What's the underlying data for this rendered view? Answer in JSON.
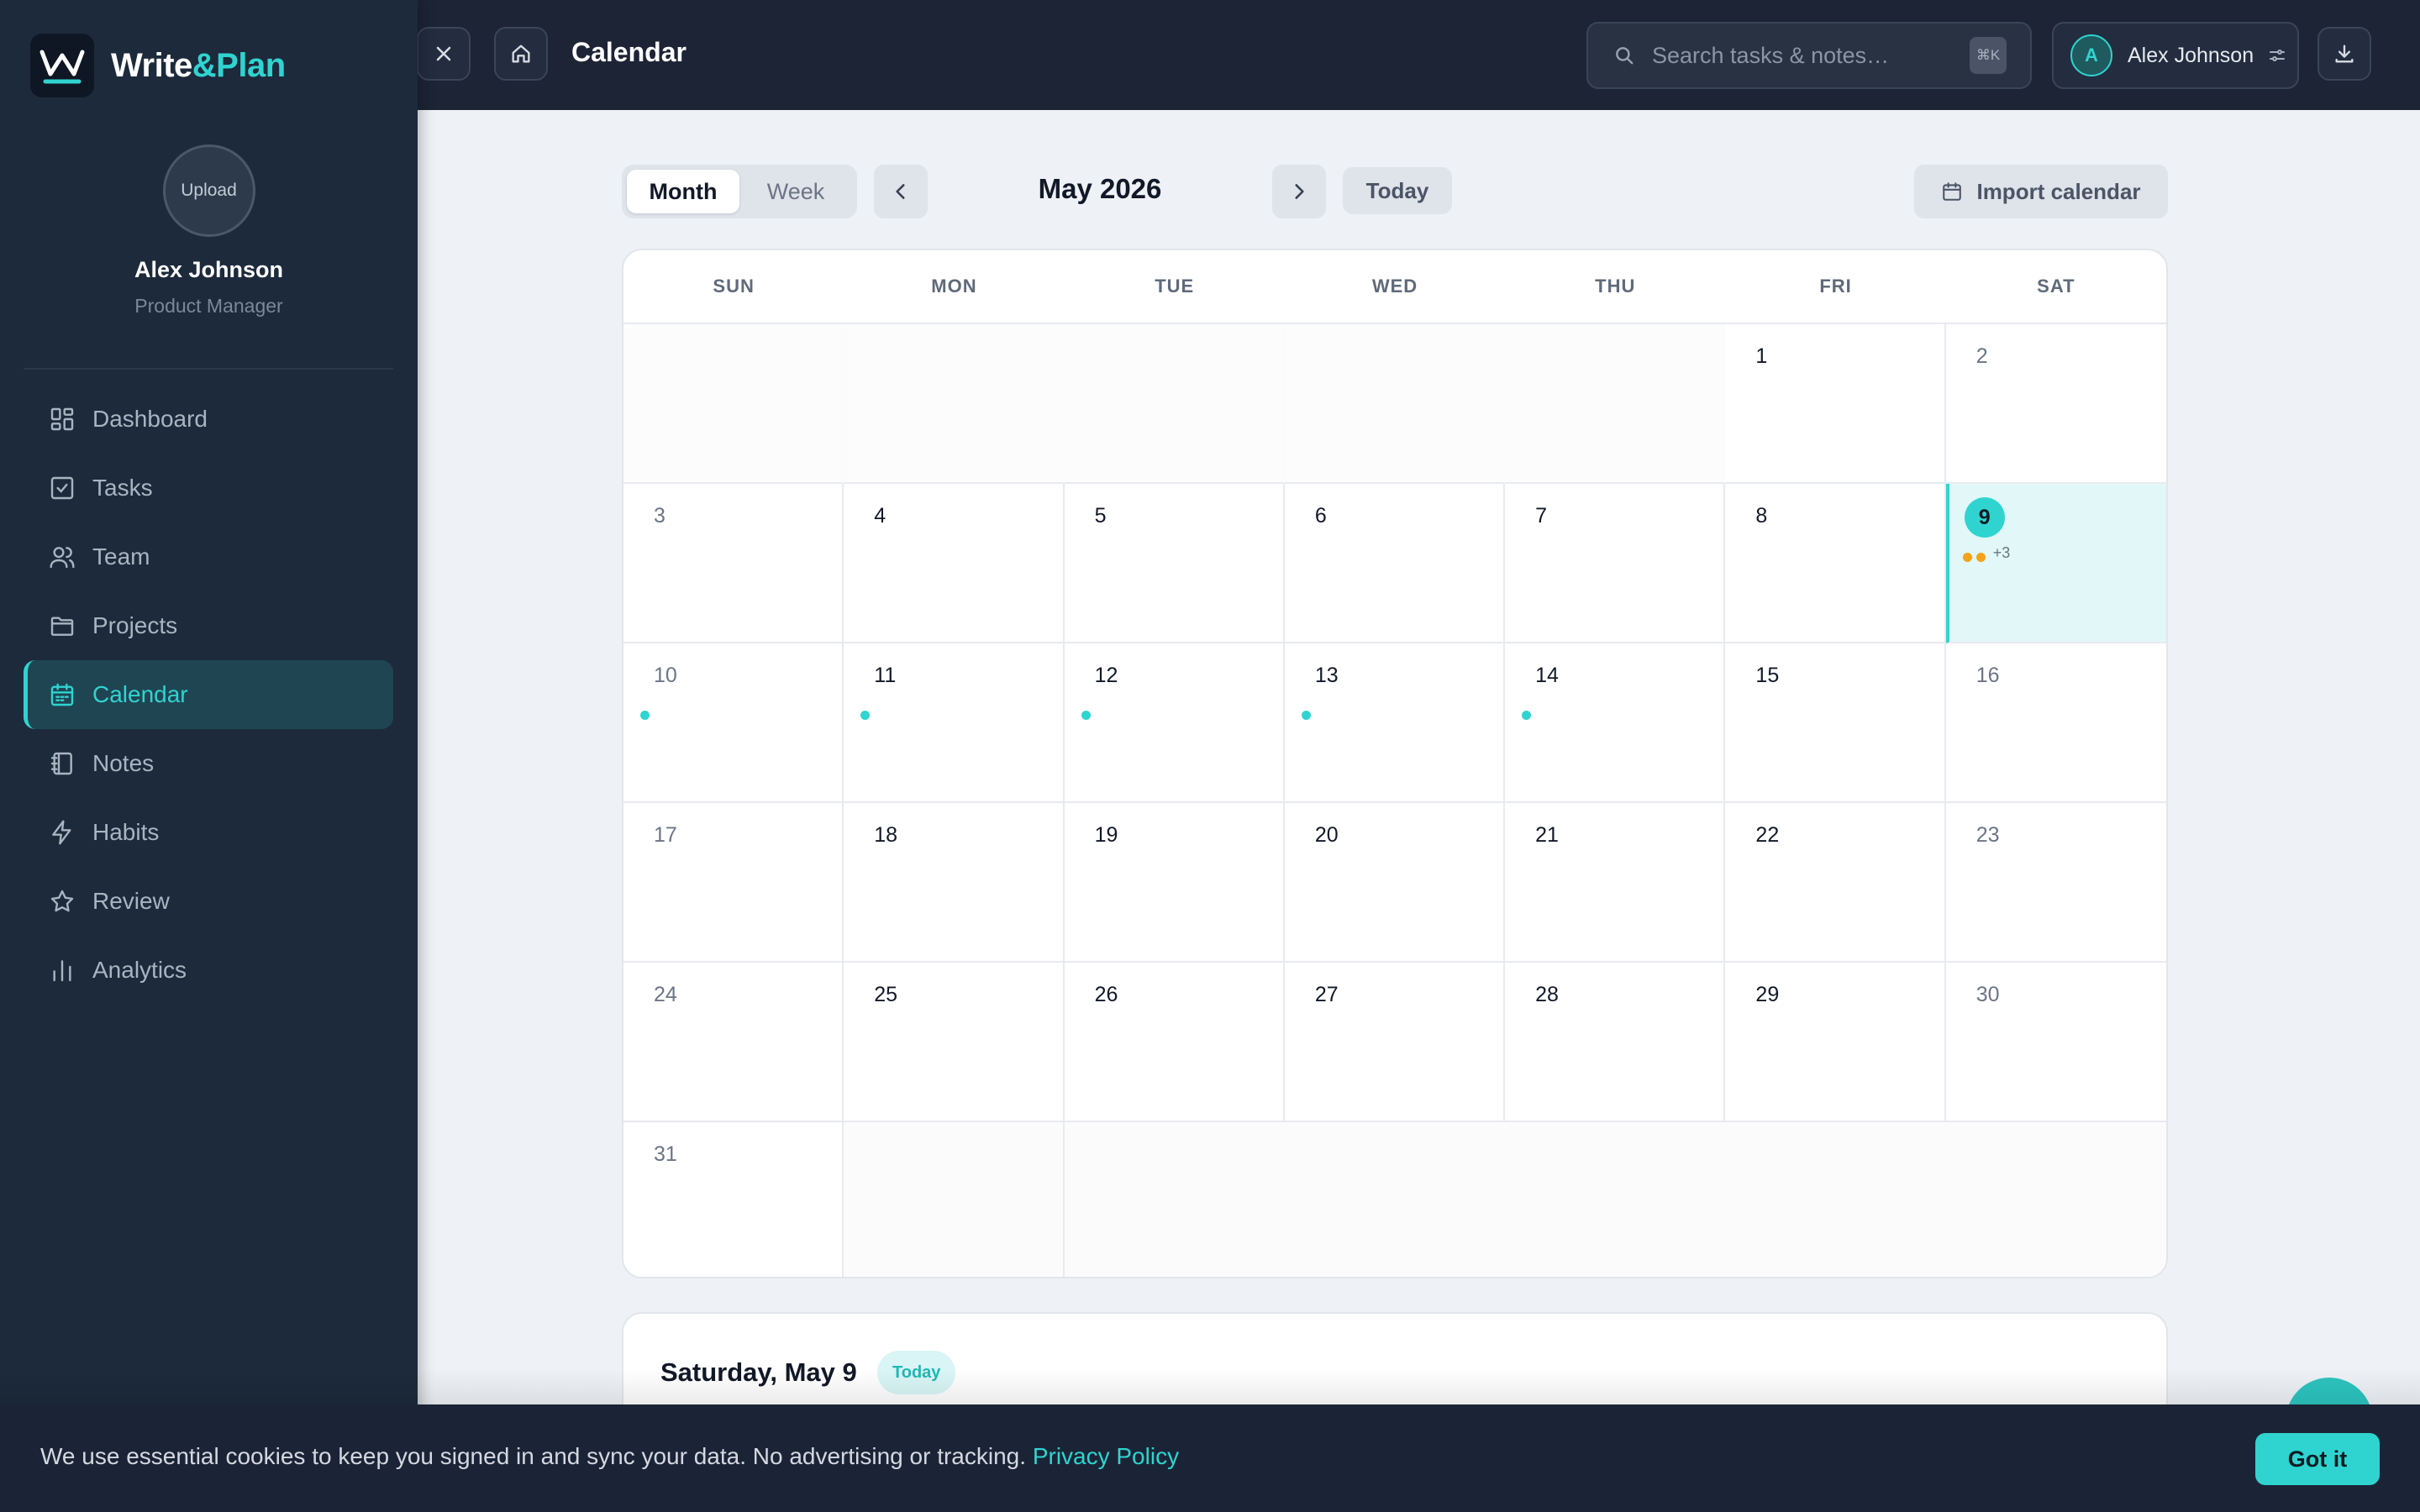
{
  "app": {
    "name_part1": "Write",
    "name_part2": "&Plan"
  },
  "profile": {
    "upload_label": "Upload",
    "name": "Alex Johnson",
    "role": "Product Manager"
  },
  "sidebar": {
    "items": [
      {
        "label": "Dashboard",
        "icon": "dashboard-icon"
      },
      {
        "label": "Tasks",
        "icon": "check-square-icon"
      },
      {
        "label": "Team",
        "icon": "users-icon"
      },
      {
        "label": "Projects",
        "icon": "folder-icon"
      },
      {
        "label": "Calendar",
        "icon": "calendar-icon",
        "active": true
      },
      {
        "label": "Notes",
        "icon": "notebook-icon"
      },
      {
        "label": "Habits",
        "icon": "bolt-icon"
      },
      {
        "label": "Review",
        "icon": "star-icon"
      },
      {
        "label": "Analytics",
        "icon": "bar-chart-icon"
      }
    ]
  },
  "header": {
    "title": "Calendar",
    "search_placeholder": "Search tasks & notes…",
    "search_shortcut": "⌘K",
    "user_initial": "A",
    "user_name": "Alex Johnson"
  },
  "calendar": {
    "views": [
      "Month",
      "Week"
    ],
    "active_view": "Month",
    "month_label": "May 2026",
    "today_label": "Today",
    "import_label": "Import calendar",
    "weekdays": [
      "SUN",
      "MON",
      "TUE",
      "WED",
      "THU",
      "FRI",
      "SAT"
    ],
    "leading_blanks": 5,
    "days_in_month": 31,
    "today": 9,
    "today_more_label": "+3",
    "today_event_dots": 2,
    "days_with_events": [
      10,
      11,
      12,
      13,
      14
    ]
  },
  "day_panel": {
    "title": "Saturday, May 9",
    "badge": "Today"
  },
  "cookie": {
    "text": "We use essential cookies to keep you signed in and sync your data. No advertising or tracking.",
    "link": "Privacy Policy",
    "button": "Got it"
  },
  "colors": {
    "accent": "#2fd4d0",
    "sidebar_bg": "#1c2a3b",
    "topbar_bg": "#1c2435",
    "event_amber": "#f4a21a"
  }
}
